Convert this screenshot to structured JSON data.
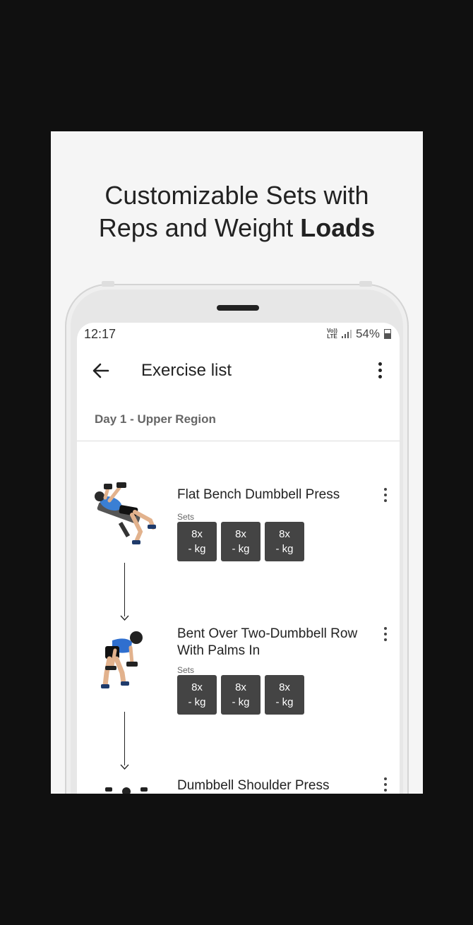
{
  "headline": {
    "line1": "Customizable Sets with",
    "line2_plain": "Reps and Weight ",
    "line2_bold": "Loads"
  },
  "status_bar": {
    "time": "12:17",
    "volte_top": "Vo))",
    "volte_bottom": "LTE",
    "battery": "54%"
  },
  "app_bar": {
    "title": "Exercise list",
    "back_icon": "arrow-left-icon",
    "menu_icon": "more-vert-icon"
  },
  "day_label": "Day 1 - Upper Region",
  "exercises": [
    {
      "name": "Flat Bench Dumbbell Press",
      "sets_label": "Sets",
      "sets": [
        {
          "reps": "8x",
          "load": "- kg"
        },
        {
          "reps": "8x",
          "load": "- kg"
        },
        {
          "reps": "8x",
          "load": "- kg"
        }
      ]
    },
    {
      "name": "Bent Over Two-Dumbbell Row With Palms In",
      "sets_label": "Sets",
      "sets": [
        {
          "reps": "8x",
          "load": "- kg"
        },
        {
          "reps": "8x",
          "load": "- kg"
        },
        {
          "reps": "8x",
          "load": "- kg"
        }
      ]
    },
    {
      "name": "Dumbbell Shoulder Press"
    }
  ],
  "colors": {
    "page_background": "#101010",
    "card_background": "#f5f5f5",
    "set_chip": "#444444",
    "text_primary": "#222222"
  }
}
